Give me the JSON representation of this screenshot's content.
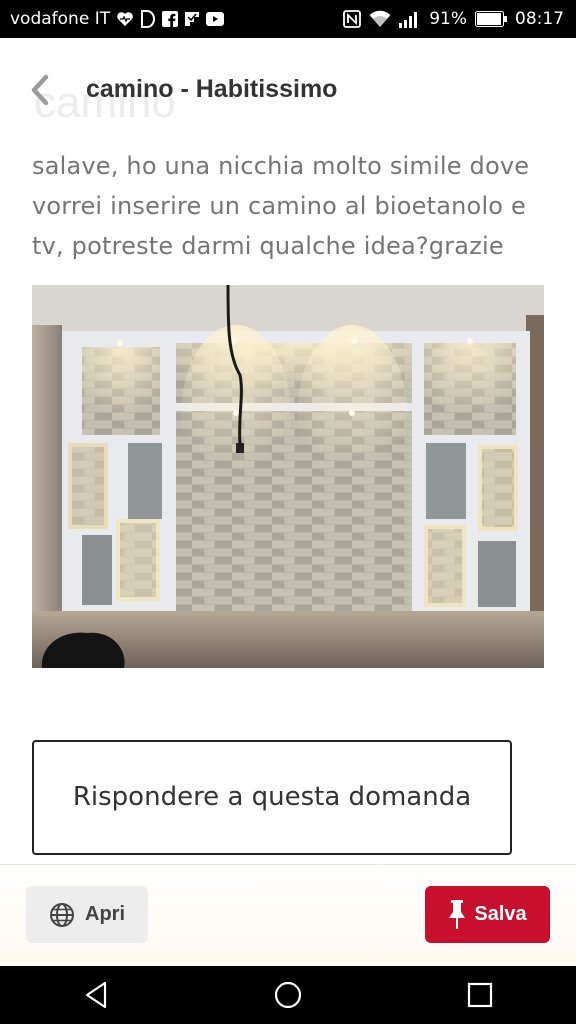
{
  "status_bar": {
    "carrier": "vodafone IT",
    "battery": "91%",
    "time": "08:17",
    "icons": [
      "heart-icon",
      "d-icon",
      "facebook-icon",
      "flipboard-icon",
      "youtube-icon",
      "nfc-icon",
      "wifi-icon",
      "signal-icon",
      "battery-icon"
    ]
  },
  "header": {
    "ghost_text": "camino",
    "title": "camino - Habitissimo",
    "back_icon": "chevron-left-icon"
  },
  "question": "salave, ho una nicchia molto simile dove vorrei inserire un camino al bioetanolo e tv, potreste darmi qualche idea?grazie",
  "answer_button": "Rispondere a questa domanda",
  "actions": {
    "open_label": "Apri",
    "open_icon": "globe-icon",
    "save_label": "Salva",
    "save_icon": "pin-icon",
    "save_color": "#c8102e"
  },
  "nav_bar": {
    "icons": [
      "back-triangle-icon",
      "home-circle-icon",
      "recents-square-icon"
    ]
  }
}
